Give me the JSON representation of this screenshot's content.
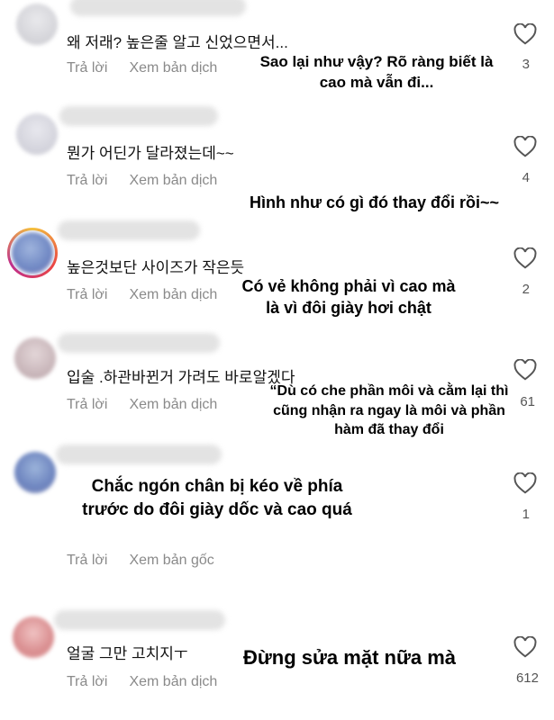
{
  "comments": [
    {
      "text": "왜 저래? 높은줄 알고 신었으면서...",
      "reply": "Trả lời",
      "translate": "Xem bản dịch",
      "likes": "3",
      "overlay": [
        "Sao lại như vậy? Rõ ràng biết là",
        "cao mà vẫn đi..."
      ]
    },
    {
      "text": "뭔가 어딘가 달라졌는데~~",
      "reply": "Trả lời",
      "translate": "Xem bản dịch",
      "likes": "4",
      "overlay": [
        "Hình như có gì đó thay đổi rồi~~"
      ]
    },
    {
      "text": "높은것보단 사이즈가 작은듯",
      "reply": "Trả lời",
      "translate": "Xem bản dịch",
      "likes": "2",
      "overlay": [
        "Có vẻ không phải vì cao mà",
        "là vì đôi giày hơi chật"
      ]
    },
    {
      "text": "입술 .하관바뀐거 가려도 바로알겠다",
      "reply": "Trả lời",
      "translate": "Xem bản dịch",
      "likes": "61",
      "overlay": [
        "“Dù có che phần môi và cằm lại thì",
        "cũng nhận ra ngay là môi và phần",
        "hàm đã thay đổi"
      ]
    },
    {
      "text": "",
      "reply": "Trả lời",
      "translate": "Xem bản gốc",
      "likes": "1",
      "overlay": [
        "Chắc ngón chân bị kéo về phía",
        "trước do đôi giày dốc và cao quá"
      ]
    },
    {
      "text": "얼굴 그만 고치지ㅜ",
      "reply": "Trả lời",
      "translate": "Xem bản dịch",
      "likes": "612",
      "overlay": [
        "Đừng sửa mặt nữa mà"
      ]
    }
  ]
}
